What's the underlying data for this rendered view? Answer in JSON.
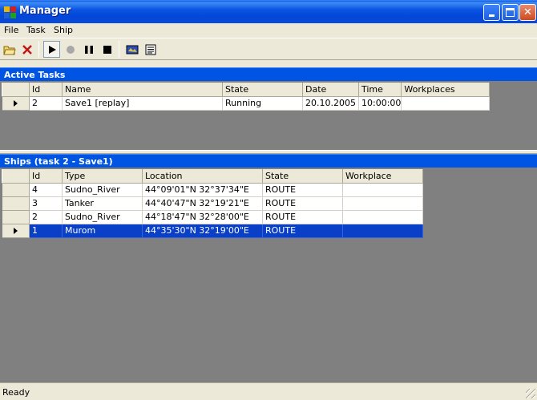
{
  "window": {
    "title": "Manager"
  },
  "menu": [
    "File",
    "Task",
    "Ship"
  ],
  "toolbar": {
    "buttons": [
      {
        "icon": "open-folder-icon"
      },
      {
        "icon": "delete-icon"
      },
      {
        "icon": "play-icon"
      },
      {
        "icon": "record-icon"
      },
      {
        "icon": "pause-icon"
      },
      {
        "icon": "stop-icon"
      },
      {
        "icon": "map-icon"
      },
      {
        "icon": "list-icon"
      }
    ]
  },
  "active_tasks": {
    "header": "Active Tasks",
    "columns": [
      "Id",
      "Name",
      "State",
      "Date",
      "Time",
      "Workplaces"
    ],
    "rows": [
      {
        "id": "2",
        "name": "Save1 [replay]",
        "state": "Running",
        "date": "20.10.2005",
        "time": "10:00:00",
        "workplaces": ""
      }
    ]
  },
  "ships": {
    "header": "Ships (task 2 - Save1)",
    "columns": [
      "Id",
      "Type",
      "Location",
      "State",
      "Workplace"
    ],
    "rows": [
      {
        "id": "4",
        "type": "Sudno_River",
        "location": "44°09'01\"N 32°37'34\"E",
        "state": "ROUTE",
        "workplace": ""
      },
      {
        "id": "3",
        "type": "Tanker",
        "location": "44°40'47\"N 32°19'21\"E",
        "state": "ROUTE",
        "workplace": ""
      },
      {
        "id": "2",
        "type": "Sudno_River",
        "location": "44°18'47\"N 32°28'00\"E",
        "state": "ROUTE",
        "workplace": ""
      },
      {
        "id": "1",
        "type": "Murom",
        "location": "44°35'30\"N 32°19'00\"E",
        "state": "ROUTE",
        "workplace": ""
      }
    ]
  },
  "status": {
    "text": "Ready"
  },
  "colors": {
    "title_bar": "#0054E3",
    "selection": "#0A3FC8",
    "panel_bg": "#808080"
  }
}
